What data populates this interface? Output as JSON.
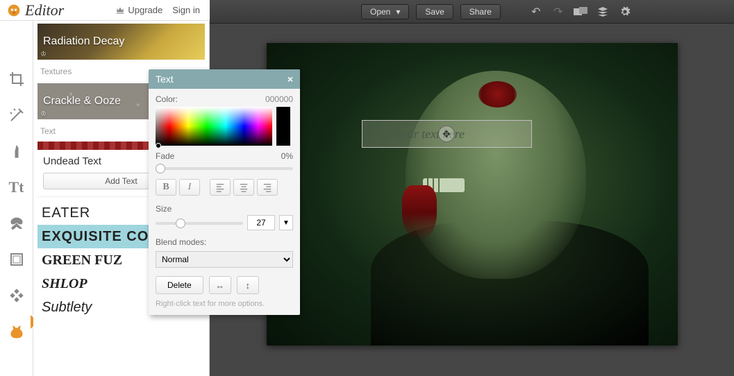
{
  "brand": {
    "name": "Editor"
  },
  "appbar": {
    "upgrade": "Upgrade",
    "signin": "Sign in"
  },
  "toolbar": {
    "open": "Open",
    "save": "Save",
    "share": "Share"
  },
  "side": {
    "radiation": "Radiation Decay",
    "textures": "Textures",
    "crackle": "Crackle & Ooze",
    "text": "Text",
    "undead": "Undead Text",
    "addtext": "Add Text",
    "fonts": {
      "eater": "EATER",
      "corpse": "EXQUISITE CORPSE",
      "fuz": "GREEN FUZ",
      "shlop": "SHLOP",
      "subtlety": "Subtlety"
    }
  },
  "panel": {
    "title": "Text",
    "color": "Color:",
    "color_val": "000000",
    "fade": "Fade",
    "fade_val": "0%",
    "size": "Size",
    "size_val": "27",
    "blend": "Blend modes:",
    "blend_val": "Normal",
    "delete": "Delete",
    "hint": "Right-click text for more options."
  },
  "canvas": {
    "placeholder": "Type your text here"
  }
}
